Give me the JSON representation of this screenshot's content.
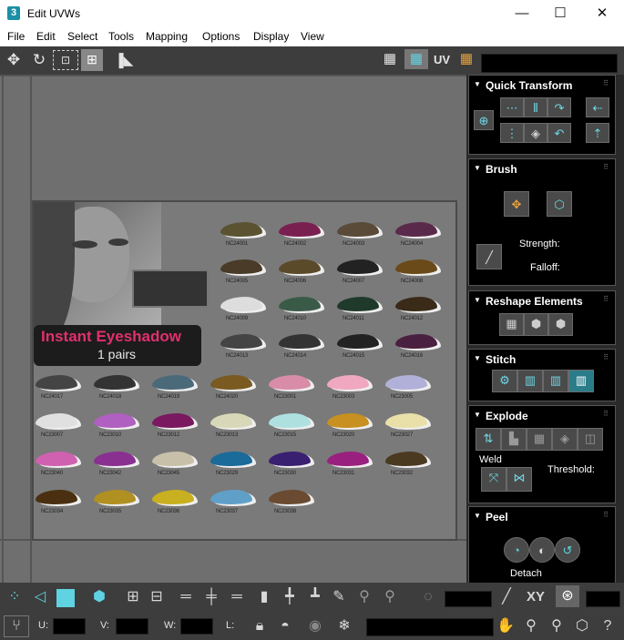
{
  "window": {
    "app_icon": "3",
    "title": "Edit UVWs",
    "minimize": "—",
    "maximize": "☐",
    "close": "✕"
  },
  "menu": [
    "File",
    "Edit",
    "Select",
    "Tools",
    "Mapping",
    "Options",
    "Display",
    "View"
  ],
  "toolbar": {
    "uv_label": "UV"
  },
  "ad": {
    "headline": "Instant Eyeshadow",
    "subline": "1 pairs",
    "codes": [
      "NC24001",
      "NC24002",
      "NC24003",
      "NC24004",
      "NC24005",
      "NC24006",
      "NC24007",
      "NC24008",
      "NC24009",
      "NC24010",
      "NC24011",
      "NC24012",
      "NC24013",
      "NC24014",
      "NC24015",
      "NC24016",
      "NC24017",
      "NC24018",
      "NC24019",
      "NC24020",
      "NC23001",
      "NC23003",
      "NC23005",
      "NC23007",
      "NC23010",
      "NC23012",
      "NC23013",
      "NC23015",
      "NC23020",
      "NC23027",
      "NC23040",
      "NC23042",
      "NC23045",
      "NC23029",
      "NC23030",
      "NC23031",
      "NC23032",
      "NC23034",
      "NC23035",
      "NC23036",
      "NC23037",
      "NC23038"
    ]
  },
  "panel": {
    "quick_transform": {
      "title": "Quick Transform"
    },
    "brush": {
      "title": "Brush",
      "strength_label": "Strength:",
      "falloff_label": "Falloff:"
    },
    "reshape": {
      "title": "Reshape Elements"
    },
    "stitch": {
      "title": "Stitch"
    },
    "explode": {
      "title": "Explode",
      "weld_label": "Weld",
      "threshold_label": "Threshold:"
    },
    "peel": {
      "title": "Peel",
      "detach_label": "Detach"
    }
  },
  "bottom": {
    "xy_label": "XY",
    "u_label": "U:",
    "v_label": "V:",
    "w_label": "W:",
    "l_label": "L:"
  },
  "colors": {
    "toolbar_bg": "#3d3d3d",
    "viewport_bg": "#6f6f6f",
    "accent": "#5fd3e2",
    "headline": "#e0306e"
  }
}
